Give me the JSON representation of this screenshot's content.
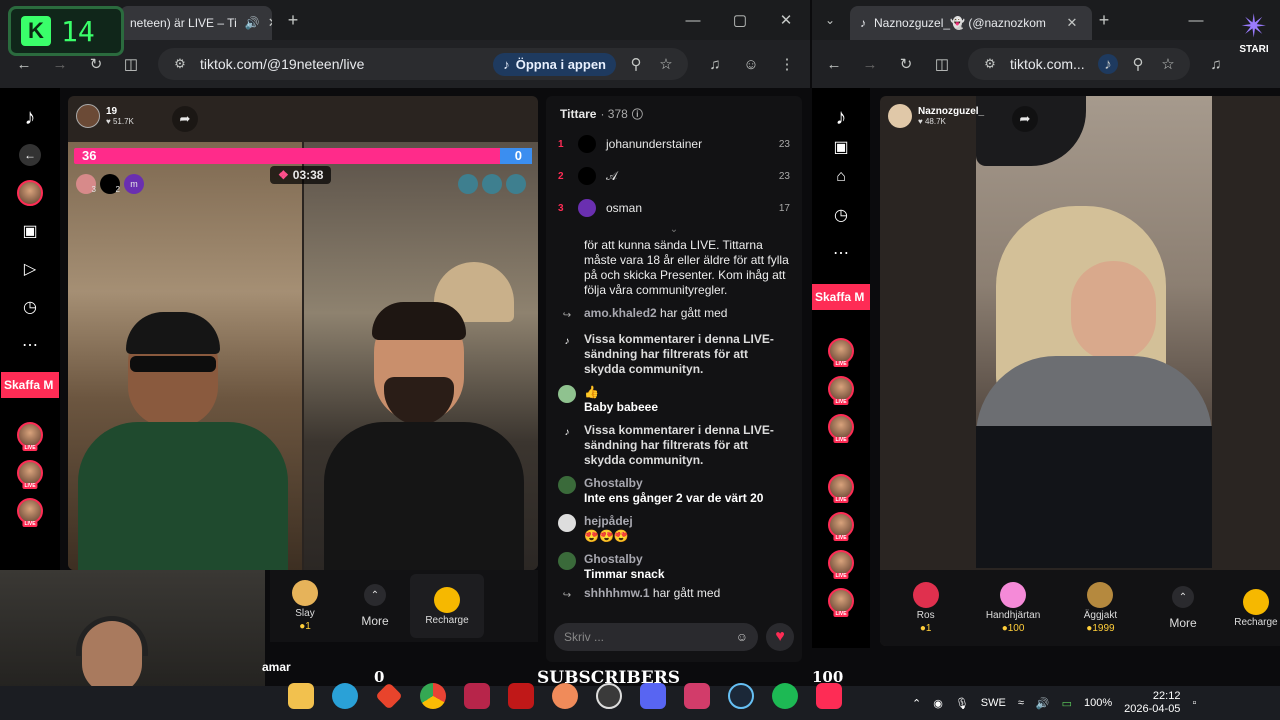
{
  "overlay": {
    "k_letter": "K",
    "k_number": "14"
  },
  "left_window": {
    "tab_title": "neteen) är LIVE – Ti",
    "url": "tiktok.com/@19neteen/live",
    "open_app": "Öppna i appen"
  },
  "right_window": {
    "tab_title": "Naznozguzel_👻 (@naznozkom",
    "url": "tiktok.com..."
  },
  "sidebar": {
    "skaffa": "Skaffa M"
  },
  "stream": {
    "host_name": "19",
    "host_likes": "♥ 51.7K",
    "score_left": "36",
    "score_right": "0",
    "timer": "03:38",
    "badges": [
      "3",
      "2",
      "1"
    ],
    "badge_m": "m"
  },
  "gifts_left": [
    {
      "name": "Slay",
      "price": "1"
    },
    {
      "name": "More",
      "price": ""
    },
    {
      "name": "Recharge",
      "price": ""
    }
  ],
  "viewers": {
    "title": "Tittare",
    "count": "· 378",
    "list": [
      {
        "rank": "1",
        "name": "johanunderstainer",
        "count": "23"
      },
      {
        "rank": "2",
        "name": "𝒜",
        "count": "23"
      },
      {
        "rank": "3",
        "name": "osman",
        "count": "17"
      }
    ]
  },
  "chat": {
    "intro": "för att kunna sända LIVE. Tittarna måste vara 18 år eller äldre för att fylla på och skicka Presenter. Kom ihåg att följa våra communityregler.",
    "joined1_user": "amo.khaled2",
    "joined1_text": "har gått med",
    "filter1": "Vissa kommentarer i denna LIVE-sändning har filtrerats för att skydda communityn.",
    "c1_user": "👍",
    "c1_text": "Baby babeee",
    "filter2": "Vissa kommentarer i denna LIVE-sändning har filtrerats för att skydda communityn.",
    "c2_user": "Ghostalby",
    "c2_text": "Inte ens gånger 2 var de värt 20",
    "c3_user": "hejpådej",
    "c3_text": "😍😍😍",
    "c4_user": "Ghostalby",
    "c4_text": "Timmar snack",
    "joined2_user": "shhhhmw.1",
    "joined2_text": "har gått med",
    "input_placeholder": "Skriv ..."
  },
  "right_stream": {
    "host_name": "Naznozguzel_",
    "host_likes": "♥ 48.7K"
  },
  "gifts_right": [
    {
      "name": "Ros",
      "price": "1"
    },
    {
      "name": "Handhjärtan",
      "price": "100"
    },
    {
      "name": "Äggjakt",
      "price": "1999"
    },
    {
      "name": "More",
      "price": ""
    },
    {
      "name": "Recharge",
      "price": ""
    }
  ],
  "webcam_caption": "amar",
  "subscribers": {
    "label": "SUBSCRIBERS",
    "start": "0",
    "end": "100"
  },
  "tray": {
    "lang": "SWE",
    "battery": "100%",
    "time": "22:12",
    "date": "2026-04-05"
  },
  "logo": {
    "text": "STARI"
  },
  "colors": {
    "tiktok_red": "#fe2c55",
    "score_pink": "#ff2b8a",
    "green_overlay": "#3aff6a"
  }
}
